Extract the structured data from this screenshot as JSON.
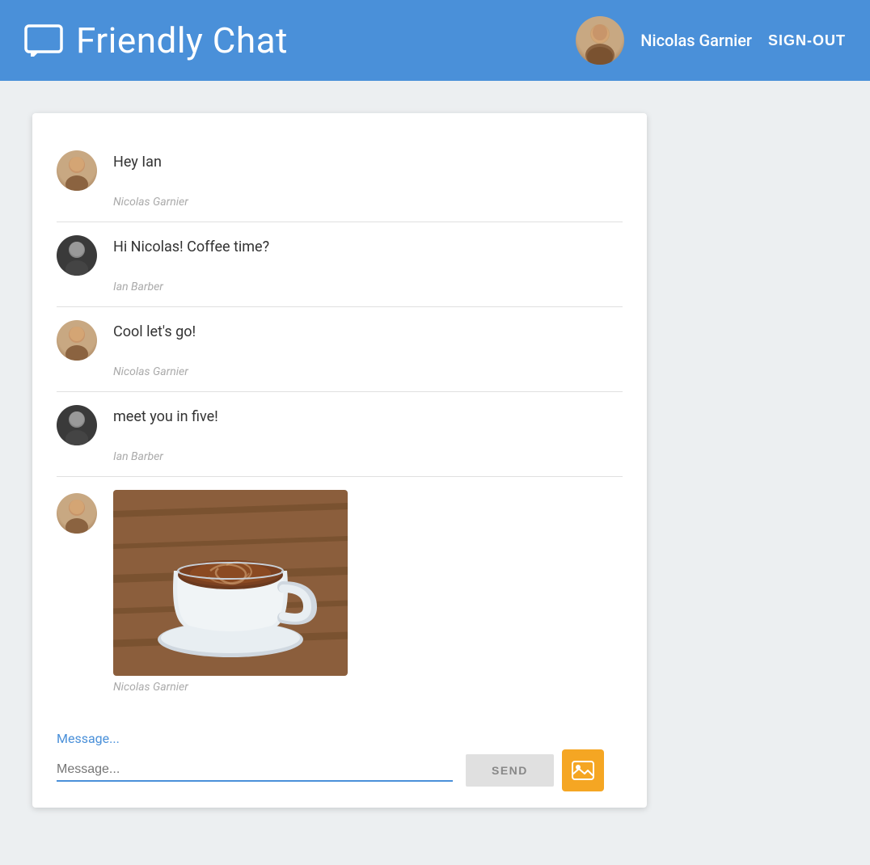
{
  "header": {
    "app_icon_label": "chat-icon",
    "title": "Friendly Chat",
    "user": {
      "name": "Nicolas Garnier",
      "avatar_alt": "Nicolas Garnier avatar"
    },
    "signout_label": "SIGN-OUT"
  },
  "chat": {
    "messages": [
      {
        "id": 1,
        "text": "Hey Ian",
        "sender": "Nicolas Garnier",
        "avatar_type": "nicolas",
        "has_image": false
      },
      {
        "id": 2,
        "text": "Hi Nicolas! Coffee time?",
        "sender": "Ian Barber",
        "avatar_type": "ian",
        "has_image": false
      },
      {
        "id": 3,
        "text": "Cool let's go!",
        "sender": "Nicolas Garnier",
        "avatar_type": "nicolas",
        "has_image": false
      },
      {
        "id": 4,
        "text": "meet you in five!",
        "sender": "Ian Barber",
        "avatar_type": "ian",
        "has_image": false
      },
      {
        "id": 5,
        "text": "",
        "sender": "Nicolas Garnier",
        "avatar_type": "nicolas",
        "has_image": true
      }
    ],
    "input": {
      "placeholder": "Message...",
      "value": ""
    },
    "send_label": "SEND",
    "image_upload_label": "image-upload"
  }
}
